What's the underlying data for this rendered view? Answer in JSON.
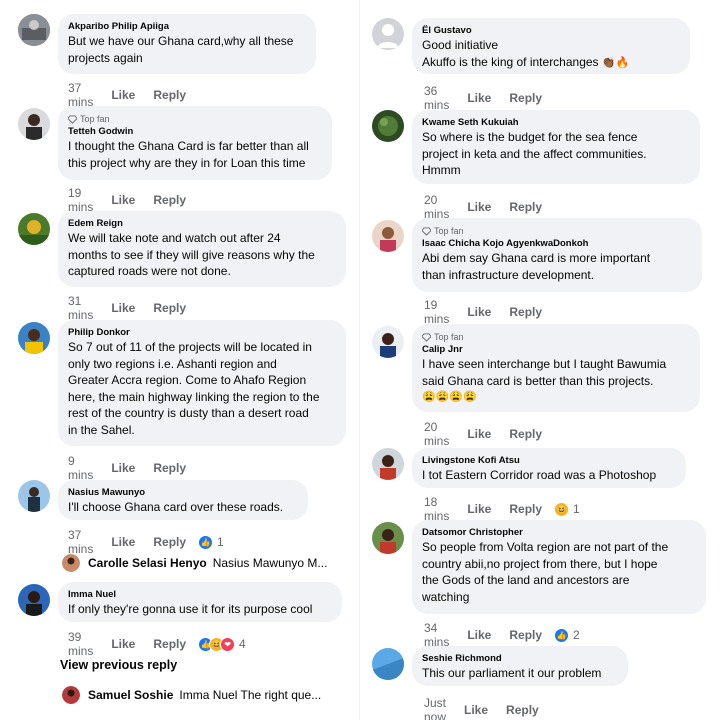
{
  "left": {
    "comments": [
      {
        "name": "Akparibo Philip Apiiga",
        "text_lines": [
          "But we have our Ghana card,why all these",
          "projects again"
        ],
        "time": "37 mins",
        "like": "Like",
        "reply": "Reply"
      },
      {
        "badge": "Top fan",
        "name": "Tetteh Godwin",
        "text_lines": [
          "I thought the Ghana Card is far better than all",
          "this project why are they in for Loan this time"
        ],
        "time": "19 mins",
        "like": "Like",
        "reply": "Reply"
      },
      {
        "name": "Edem Reign",
        "text_lines": [
          "We will take note and watch out after 24",
          "months to see if they will give reasons why the",
          "captured roads were not done."
        ],
        "time": "31 mins",
        "like": "Like",
        "reply": "Reply"
      },
      {
        "name": "Philip Donkor",
        "text_lines": [
          "So 7 out of 11 of the projects will be located in",
          "only two regions i.e. Ashanti region and",
          "Greater Accra region. Come to Ahafo Region",
          "here, the main highway linking the region to the",
          "rest of the country is dusty than a desert road",
          "in the Sahel."
        ],
        "time": "9 mins",
        "like": "Like",
        "reply": "Reply"
      },
      {
        "name": "Nasius Mawunyo",
        "text_lines": [
          "I'll choose Ghana card over these roads."
        ],
        "time": "37 mins",
        "like": "Like",
        "reply": "Reply",
        "reaction_count": "1"
      },
      {
        "name": "Imma Nuel",
        "text_lines": [
          "If only they're gonna use it for its purpose cool"
        ],
        "time": "39 mins",
        "like": "Like",
        "reply": "Reply",
        "reaction_count": "4"
      }
    ],
    "reply_preview_1": {
      "name": "Carolle Selasi Henyo",
      "text": "Nasius Mawunyo M..."
    },
    "view_previous": "View previous reply",
    "reply_preview_2": {
      "name": "Samuel Soshie",
      "text": "Imma Nuel The right que..."
    }
  },
  "right": {
    "comments": [
      {
        "name": "Ël Gustavo",
        "text_lines": [
          "Good initiative",
          "Akuffo is the king of interchanges"
        ],
        "time": "36 mins",
        "like": "Like",
        "reply": "Reply"
      },
      {
        "name": "Kwame Seth Kukuiah",
        "text_lines": [
          "So where is the budget for the sea fence",
          "project in keta and the affect communities.",
          "Hmmm"
        ],
        "time": "20 mins",
        "like": "Like",
        "reply": "Reply"
      },
      {
        "badge": "Top fan",
        "name": "Isaac Chicha Kojo AgyenkwaDonkoh",
        "text_lines": [
          "Abi dem say Ghana card is more important",
          "than infrastructure development."
        ],
        "time": "19 mins",
        "like": "Like",
        "reply": "Reply"
      },
      {
        "badge": "Top fan",
        "name": "Calip Jnr",
        "text_lines": [
          "I have seen interchange but I taught Bawumia",
          "said Ghana card is better than this projects."
        ],
        "time": "20 mins",
        "like": "Like",
        "reply": "Reply"
      },
      {
        "name": "Livingstone Kofi Atsu",
        "text_lines": [
          "I tot Eastern Corridor road was a Photoshop"
        ],
        "time": "18 mins",
        "like": "Like",
        "reply": "Reply",
        "reaction_count": "1"
      },
      {
        "name": "Datsomor Christopher",
        "text_lines": [
          "So people from Volta region are not part of the",
          "country abii,no project from there, but I hope",
          "the Gods of the land and ancestors are",
          "watching"
        ],
        "time": "34 mins",
        "like": "Like",
        "reply": "Reply",
        "reaction_count": "2"
      },
      {
        "name": "Seshie Richmond",
        "text_lines": [
          "This our parliament it our problem"
        ],
        "time": "Just now",
        "like": "Like",
        "reply": "Reply"
      }
    ]
  },
  "colors": {
    "bubble": "#f0f2f5",
    "meta": "#65676b",
    "like_blue": "#1877f2",
    "haha": "#f7b125",
    "love": "#f33e58"
  }
}
